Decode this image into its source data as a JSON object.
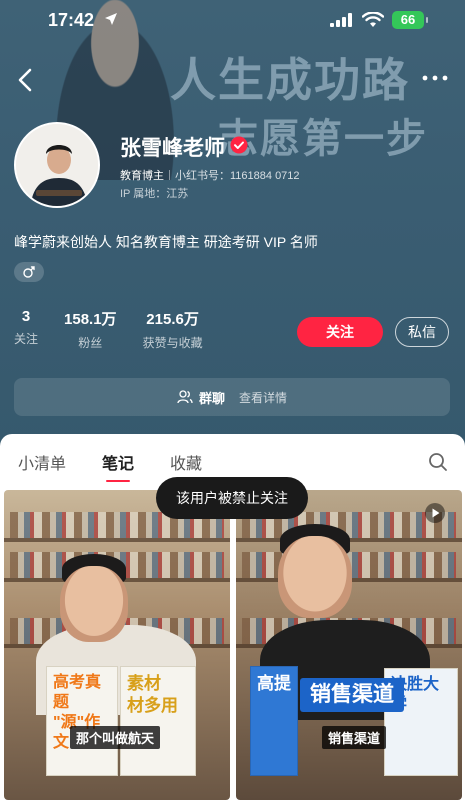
{
  "status_bar": {
    "time": "17:42",
    "battery": "66"
  },
  "header": {
    "banner_line1": "人生成功路",
    "banner_line2": "志愿第一步"
  },
  "profile": {
    "name": "张雪峰老师",
    "tag": "教育博主",
    "xiaohongshu_id": "小红书号：1161884 0712",
    "ip_location": "IP 属地：江苏",
    "bio": "峰学蔚来创始人 知名教育博主 研途考研 VIP 名师",
    "stats": [
      {
        "value": "3",
        "label": "关注"
      },
      {
        "value": "158.1万",
        "label": "粉丝"
      },
      {
        "value": "215.6万",
        "label": "获赞与收藏"
      }
    ],
    "follow_label": "关注",
    "message_label": "私信"
  },
  "group": {
    "title": "群聊",
    "subtitle": "查看详情"
  },
  "tabs": [
    {
      "label": "小清单",
      "active": false
    },
    {
      "label": "笔记",
      "active": true
    },
    {
      "label": "收藏",
      "active": false
    }
  ],
  "toast": "该用户被禁止关注",
  "notes": [
    {
      "book_left_line1": "高考真题",
      "book_left_line2": "\"源\"作文",
      "book_right_line1": "素材",
      "book_right_line2": "材多用",
      "caption": "那个叫做航天"
    },
    {
      "book_left": "高提",
      "banner_text": "销售渠道",
      "book_right": "决胜大学",
      "caption": "销售渠道"
    }
  ],
  "colors": {
    "accent": "#ff2442",
    "header_bg": "#3a5d72",
    "battery": "#34c759"
  }
}
